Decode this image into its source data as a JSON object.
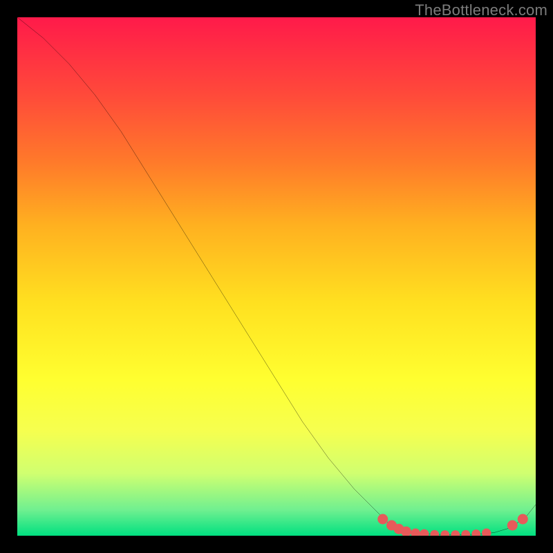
{
  "attribution": "TheBottleneck.com",
  "chart_data": {
    "type": "line",
    "title": "",
    "xlabel": "",
    "ylabel": "",
    "xlim": [
      0,
      100
    ],
    "ylim": [
      0,
      100
    ],
    "series": [
      {
        "name": "curve",
        "x": [
          0,
          5,
          10,
          15,
          20,
          25,
          30,
          35,
          40,
          45,
          50,
          55,
          60,
          65,
          70,
          72,
          75,
          78,
          80,
          83,
          86,
          89,
          92,
          95,
          98,
          100
        ],
        "y": [
          100,
          96,
          91,
          85,
          78,
          70,
          62,
          54,
          46,
          38,
          30,
          22,
          15,
          9,
          4,
          2,
          1,
          0.5,
          0.3,
          0.2,
          0.2,
          0.3,
          0.6,
          1.5,
          3.5,
          6
        ]
      }
    ],
    "markers": [
      {
        "x": 70.5,
        "y": 3.2,
        "r": 1.0
      },
      {
        "x": 72.2,
        "y": 2.0,
        "r": 1.0
      },
      {
        "x": 73.6,
        "y": 1.3,
        "r": 1.0
      },
      {
        "x": 75.0,
        "y": 0.8,
        "r": 1.0
      },
      {
        "x": 76.8,
        "y": 0.5,
        "r": 0.9
      },
      {
        "x": 78.5,
        "y": 0.35,
        "r": 0.9
      },
      {
        "x": 80.5,
        "y": 0.25,
        "r": 0.85
      },
      {
        "x": 82.5,
        "y": 0.2,
        "r": 0.85
      },
      {
        "x": 84.5,
        "y": 0.2,
        "r": 0.85
      },
      {
        "x": 86.5,
        "y": 0.25,
        "r": 0.85
      },
      {
        "x": 88.5,
        "y": 0.35,
        "r": 0.85
      },
      {
        "x": 90.5,
        "y": 0.5,
        "r": 0.9
      },
      {
        "x": 95.5,
        "y": 2.0,
        "r": 1.0
      },
      {
        "x": 97.5,
        "y": 3.2,
        "r": 1.0
      }
    ],
    "marker_color": "#e75a5a",
    "curve_color": "#000000"
  }
}
